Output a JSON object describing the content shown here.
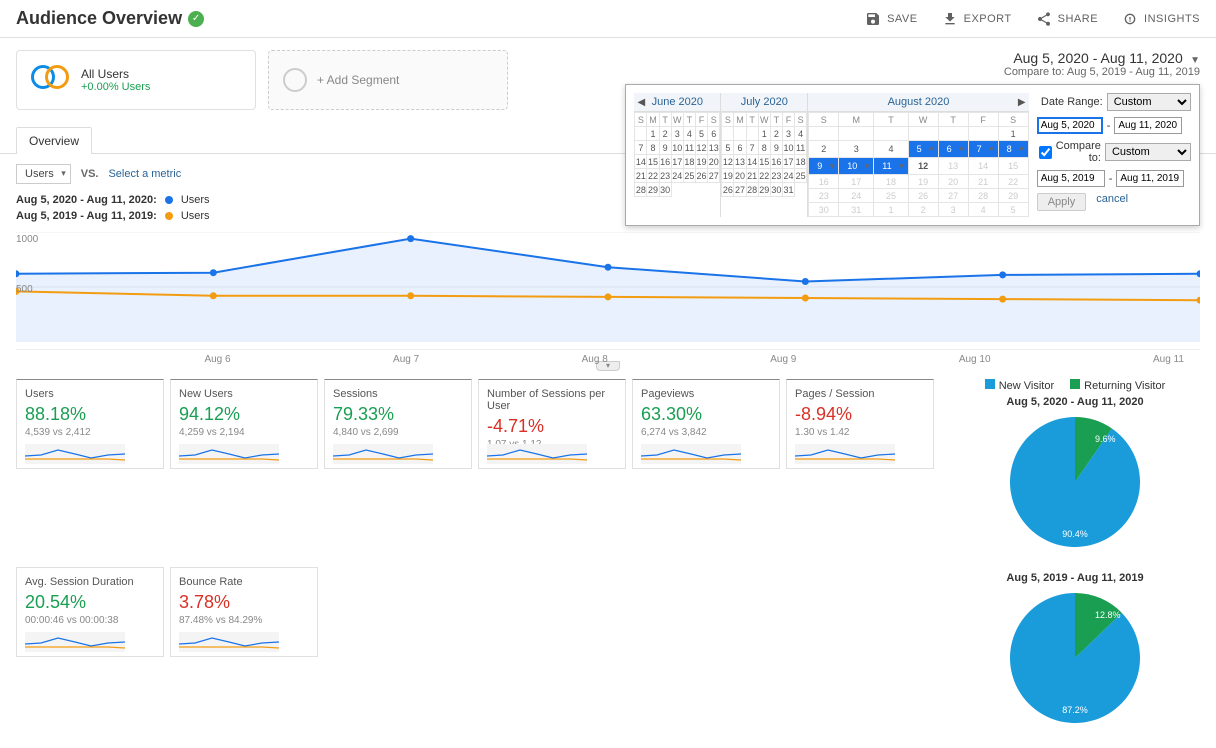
{
  "page_title": "Audience Overview",
  "top_actions": {
    "save": "SAVE",
    "export": "EXPORT",
    "share": "SHARE",
    "insights": "INSIGHTS"
  },
  "segment_card": {
    "title": "All Users",
    "sub": "+0.00% Users"
  },
  "add_segment": "+ Add Segment",
  "date_range": {
    "range": "Aug 5, 2020 - Aug 11, 2020",
    "compare_prefix": "Compare to: ",
    "compare_range": "Aug 5, 2019 - Aug 11, 2019"
  },
  "tab": {
    "overview": "Overview"
  },
  "controls": {
    "dim": "Users",
    "vs": "VS.",
    "select_metric": "Select a metric"
  },
  "legend": {
    "a": {
      "prefix": "Aug 5, 2020 - Aug 11, 2020:",
      "label": "Users",
      "color": "#1a73e8"
    },
    "b": {
      "prefix": "Aug 5, 2019 - Aug 11, 2019:",
      "label": "Users",
      "color": "#f39c12"
    }
  },
  "chart_data": {
    "type": "line",
    "categories": [
      "…",
      "Aug 6",
      "Aug 7",
      "Aug 8",
      "Aug 9",
      "Aug 10",
      "Aug 11"
    ],
    "yticks": [
      500,
      1000
    ],
    "series": [
      {
        "name": "Aug 5, 2020 - Aug 11, 2020",
        "color": "#1a73e8",
        "fill": true,
        "values": [
          620,
          630,
          940,
          680,
          550,
          610,
          620
        ]
      },
      {
        "name": "Aug 5, 2019 - Aug 11, 2019",
        "color": "#f39c12",
        "fill": false,
        "values": [
          460,
          420,
          420,
          410,
          400,
          390,
          380
        ]
      }
    ]
  },
  "metrics": [
    {
      "label": "Users",
      "pct": "88.18%",
      "pos": true,
      "detail": "4,539 vs 2,412"
    },
    {
      "label": "New Users",
      "pct": "94.12%",
      "pos": true,
      "detail": "4,259 vs 2,194"
    },
    {
      "label": "Sessions",
      "pct": "79.33%",
      "pos": true,
      "detail": "4,840 vs 2,699"
    },
    {
      "label": "Number of Sessions per User",
      "pct": "-4.71%",
      "pos": false,
      "detail": "1.07 vs 1.12"
    },
    {
      "label": "Pageviews",
      "pct": "63.30%",
      "pos": true,
      "detail": "6,274 vs 3,842"
    },
    {
      "label": "Pages / Session",
      "pct": "-8.94%",
      "pos": false,
      "detail": "1.30 vs 1.42"
    },
    {
      "label": "Avg. Session Duration",
      "pct": "20.54%",
      "pos": true,
      "detail": "00:00:46 vs 00:00:38"
    },
    {
      "label": "Bounce Rate",
      "pct": "3.78%",
      "pos": false,
      "detail": "87.48% vs 84.29%"
    }
  ],
  "pie_legend": {
    "new": "New Visitor",
    "returning": "Returning Visitor"
  },
  "pies": [
    {
      "title": "Aug 5, 2020 - Aug 11, 2020",
      "new": 90.4,
      "returning": 9.6,
      "new_label": "90.4%",
      "ret_label": "9.6%"
    },
    {
      "title": "Aug 5, 2019 - Aug 11, 2019",
      "new": 87.2,
      "returning": 12.8,
      "new_label": "87.2%",
      "ret_label": "12.8%"
    }
  ],
  "picker": {
    "date_range_label": "Date Range:",
    "custom": "Custom",
    "compare_to": "Compare to:",
    "start1": "Aug 5, 2020",
    "end1": "Aug 11, 2020",
    "start2": "Aug 5, 2019",
    "end2": "Aug 11, 2019",
    "apply": "Apply",
    "cancel": "cancel",
    "months": [
      {
        "name": "June 2020",
        "first_dow": 1,
        "days": 30,
        "sel": []
      },
      {
        "name": "July 2020",
        "first_dow": 3,
        "days": 31,
        "sel": []
      },
      {
        "name": "August 2020",
        "first_dow": 6,
        "days": 31,
        "sel": [
          5,
          6,
          7,
          8,
          9,
          10,
          11
        ],
        "today": 12,
        "trail": true
      }
    ],
    "dows": [
      "S",
      "M",
      "T",
      "W",
      "T",
      "F",
      "S"
    ]
  }
}
